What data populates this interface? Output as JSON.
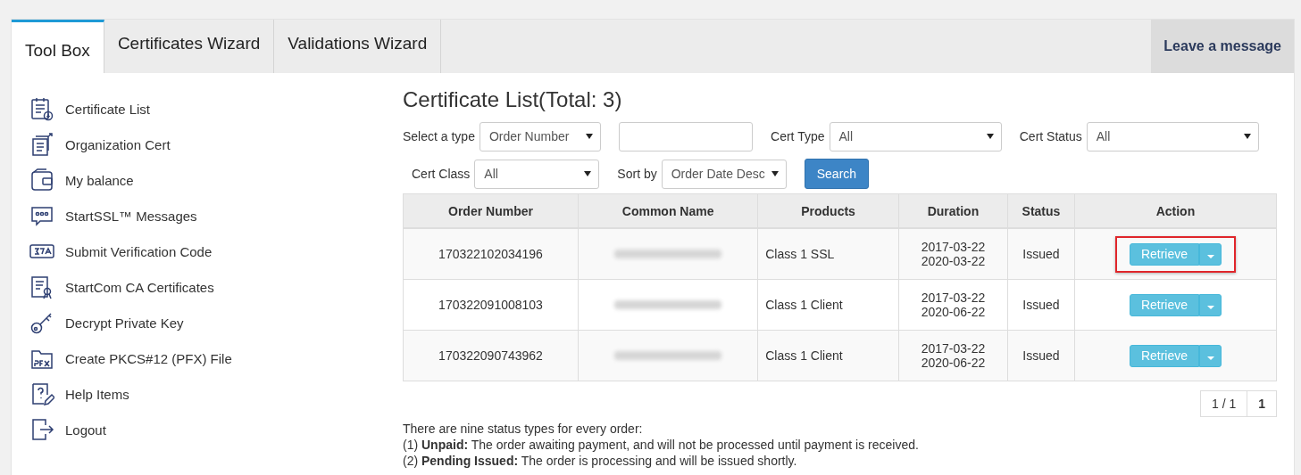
{
  "tabs": [
    {
      "label": "Tool Box",
      "selected": true
    },
    {
      "label": "Certificates Wizard",
      "selected": false
    },
    {
      "label": "Validations Wizard",
      "selected": false
    }
  ],
  "leave_message": "Leave a message",
  "sidebar": {
    "items": [
      {
        "label": "Certificate List",
        "kind": "list"
      },
      {
        "label": "Organization Cert",
        "kind": "org"
      },
      {
        "label": "My balance",
        "kind": "wallet"
      },
      {
        "label": "StartSSL™ Messages",
        "kind": "message"
      },
      {
        "label": "Submit Verification Code",
        "kind": "code"
      },
      {
        "label": "StartCom CA Certificates",
        "kind": "award"
      },
      {
        "label": "Decrypt Private Key",
        "kind": "key"
      },
      {
        "label": "Create PKCS#12 (PFX) File",
        "kind": "pfx"
      },
      {
        "label": "Help Items",
        "kind": "help"
      },
      {
        "label": "Logout",
        "kind": "logout"
      }
    ]
  },
  "title": "Certificate List(Total: 3)",
  "filters": [
    {
      "label": "Select a type",
      "kind": "select",
      "value": "Order Number"
    },
    {
      "kind": "input"
    },
    {
      "label": "Cert Type",
      "kind": "select",
      "value": "All"
    },
    {
      "label": "Cert Status",
      "kind": "select",
      "value": "All"
    },
    {
      "label": "Cert Class",
      "kind": "select",
      "value": "All"
    },
    {
      "label": "Sort by",
      "kind": "select",
      "value": "Order Date Desc"
    }
  ],
  "search_button": "Search",
  "table": {
    "columns": [
      "Order Number",
      "Common Name",
      "Products",
      "Duration",
      "Status",
      "Action"
    ],
    "rows": [
      {
        "order": "170322102034196",
        "product": "Class 1 SSL",
        "start": "2017-03-22",
        "end": "2020-03-22",
        "status": "Issued",
        "action": "Retrieve",
        "highlighted": true
      },
      {
        "order": "170322091008103",
        "product": "Class 1 Client",
        "start": "2017-03-22",
        "end": "2020-06-22",
        "status": "Issued",
        "action": "Retrieve",
        "highlighted": false
      },
      {
        "order": "170322090743962",
        "product": "Class 1 Client",
        "start": "2017-03-22",
        "end": "2020-06-22",
        "status": "Issued",
        "action": "Retrieve",
        "highlighted": false
      }
    ]
  },
  "pagination": [
    {
      "label": "1 / 1",
      "selected": false
    },
    {
      "label": "1",
      "selected": true
    }
  ],
  "notes": [
    "There are nine status types for every order:",
    "(1) **Unpaid:** The order awaiting payment, and will not be processed until payment is received.",
    "(2) **Pending Issued:** The order is processing and will be issued shortly."
  ]
}
